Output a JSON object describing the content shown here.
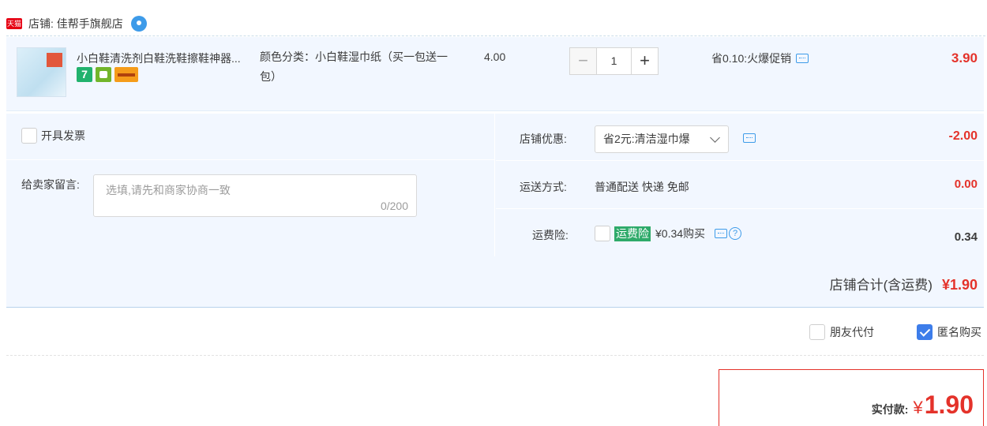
{
  "shop": {
    "label": "店铺: 佳帮手旗舰店",
    "badge": "天猫"
  },
  "item": {
    "title": "小白鞋清洗剂白鞋洗鞋擦鞋神器...",
    "sku": "颜色分类：小白鞋湿巾纸（买一包送一包）",
    "unit_price": "4.00",
    "quantity": "1",
    "minus": "−",
    "plus": "+",
    "promo": "省0.10:火爆促销",
    "total": "3.90",
    "badge_7": "7"
  },
  "invoice_label": "开具发票",
  "memo": {
    "label": "给卖家留言:",
    "placeholder": "选填,请先和商家协商一致",
    "count": "0/200"
  },
  "discount": {
    "label": "店铺优惠:",
    "selected": "省2元:清洁湿巾爆",
    "value": "-2.00"
  },
  "shipping": {
    "label": "运送方式:",
    "text": "普通配送 快递 免邮",
    "value": "0.00"
  },
  "insurance": {
    "label": "运费险:",
    "badge": "运费险",
    "price": "¥0.34购买",
    "value": "0.34",
    "help": "?"
  },
  "shop_total": {
    "label": "店铺合计(含运费)",
    "value": "¥1.90"
  },
  "options": {
    "friend_pay": "朋友代付",
    "anonymous": "匿名购买",
    "anonymous_checked": true
  },
  "payment": {
    "label": "实付款:",
    "currency": "¥",
    "amount": "1.90"
  },
  "colors": {
    "price_red": "#e4322a",
    "link_blue": "#3d9be9",
    "panel_bg": "#f2f7ff"
  }
}
